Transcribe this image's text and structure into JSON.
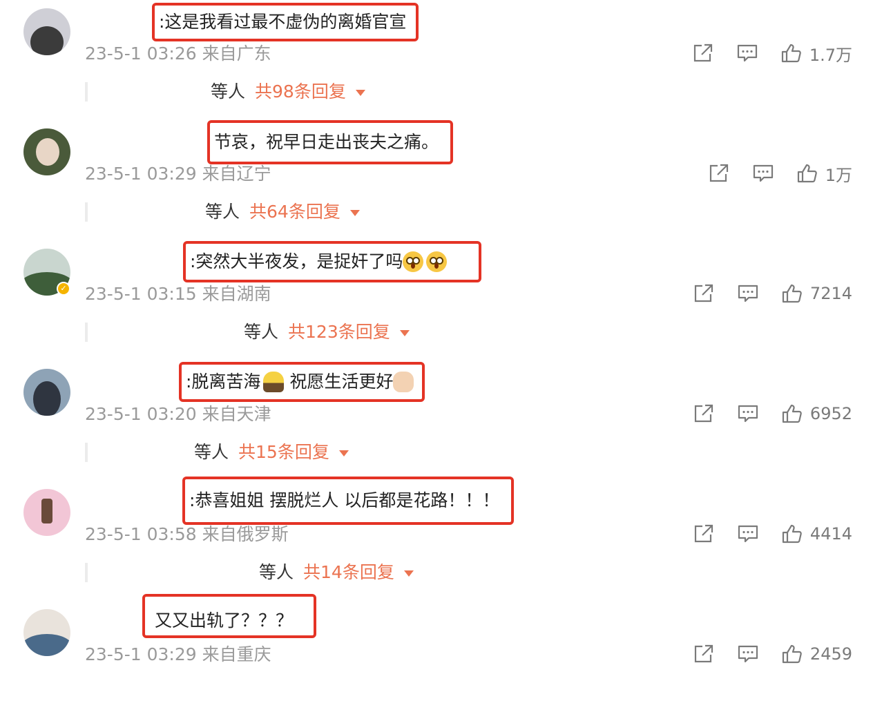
{
  "comments": [
    {
      "text": ":这是我看过最不虚伪的离婚官宣",
      "time": "23-5-1 03:26",
      "location": "来自广东",
      "likes": "1.7万",
      "reply_who": "等人",
      "reply_count": "共98条回复",
      "avatar_colors": [
        "#cfcfd6",
        "#3b3b3b"
      ]
    },
    {
      "text": "节哀，祝早日走出丧夫之痛。",
      "time": "23-5-1 03:29",
      "location": "来自辽宁",
      "likes": "1万",
      "reply_who": "等人",
      "reply_count": "共64条回复",
      "avatar_colors": [
        "#4a5a3a",
        "#e8d6c6"
      ]
    },
    {
      "text": ":突然大半夜发，是捉奸了吗",
      "time": "23-5-1 03:15",
      "location": "来自湖南",
      "likes": "7214",
      "reply_who": "等人",
      "reply_count": "共123条回复",
      "avatar_colors": [
        "#3e5e3a",
        "#c9d6cf"
      ],
      "verified": true
    },
    {
      "text": ":脱离苦海",
      "text2": "祝愿生活更好",
      "time": "23-5-1 03:20",
      "location": "来自天津",
      "likes": "6952",
      "reply_who": "等人",
      "reply_count": "共15条回复",
      "avatar_colors": [
        "#8ea3b6",
        "#2f3540"
      ]
    },
    {
      "text": ":恭喜姐姐 摆脱烂人 以后都是花路！！！",
      "time": "23-5-1 03:58",
      "location": "来自俄罗斯",
      "likes": "4414",
      "reply_who": "等人",
      "reply_count": "共14条回复",
      "avatar_colors": [
        "#f2c6d6",
        "#6a4a3a"
      ]
    },
    {
      "text": "又又出轨了？？？",
      "time": "23-5-1 03:29",
      "location": "来自重庆",
      "likes": "2459",
      "avatar_colors": [
        "#4a6a8a",
        "#e9e3dc"
      ]
    }
  ],
  "icons": {
    "share": "share-icon",
    "comment": "comment-icon",
    "like": "like-icon",
    "expand": "caret-down-icon"
  },
  "colors": {
    "highlight_box": "#e43325",
    "reply_accent": "#eb7350",
    "meta_gray": "#9a9a9a"
  }
}
